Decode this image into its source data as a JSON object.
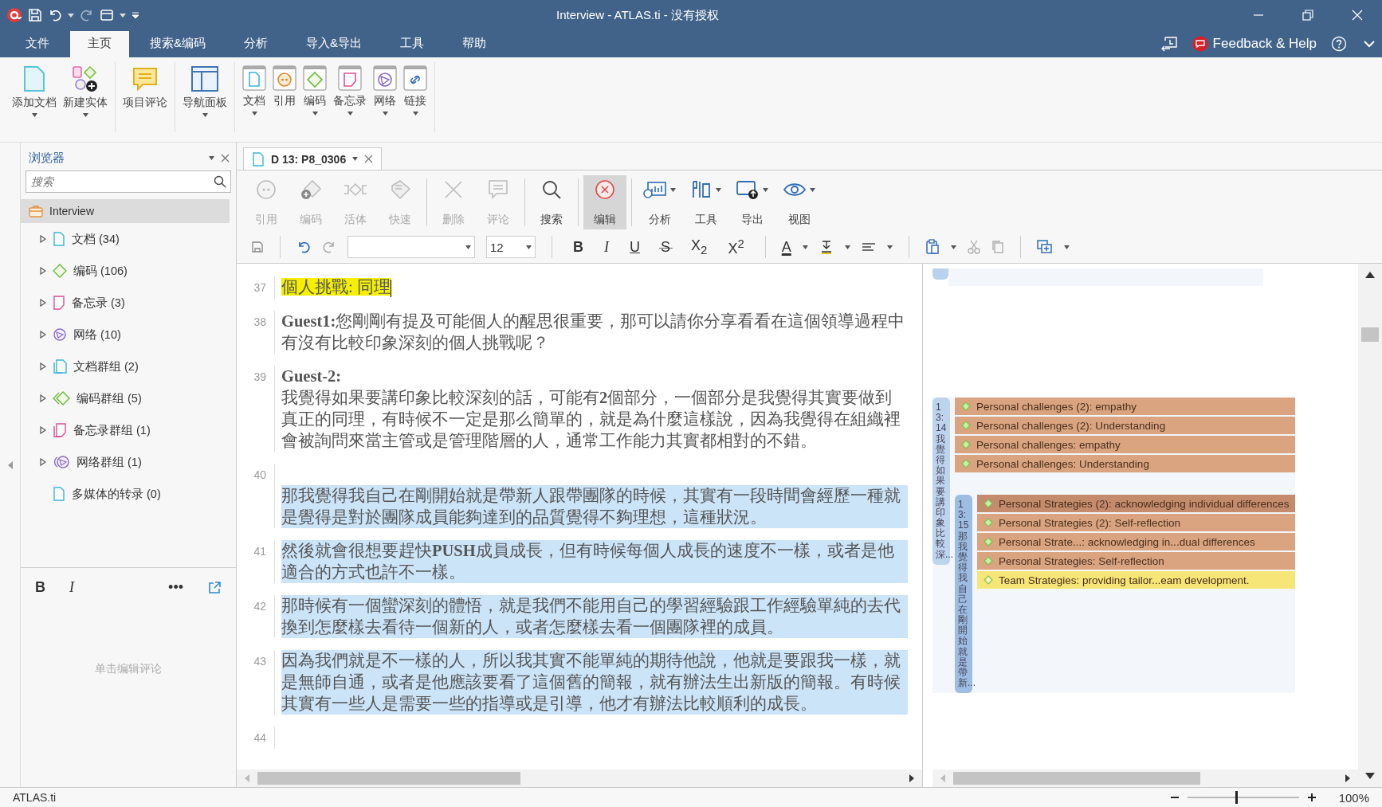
{
  "window": {
    "title": "Interview - ATLAS.ti - 没有授权"
  },
  "menu_tabs": [
    {
      "label": "文件",
      "selected": false
    },
    {
      "label": "主页",
      "selected": true
    },
    {
      "label": "搜索&编码",
      "selected": false
    },
    {
      "label": "分析",
      "selected": false
    },
    {
      "label": "导入&导出",
      "selected": false
    },
    {
      "label": "工具",
      "selected": false
    },
    {
      "label": "帮助",
      "selected": false
    }
  ],
  "feedback": "Feedback & Help",
  "ribbon": [
    [
      {
        "label": "添加文档",
        "kind": "add-doc",
        "dropdown": true
      },
      {
        "label": "新建实体",
        "kind": "new-entity",
        "dropdown": true
      }
    ],
    [
      {
        "label": "项目评论",
        "kind": "comment",
        "dropdown": false
      }
    ],
    [
      {
        "label": "导航面板",
        "kind": "nav",
        "dropdown": true
      }
    ],
    [
      {
        "label": "文档",
        "kind": "doc",
        "dropdown": true
      },
      {
        "label": "引用",
        "kind": "quote",
        "dropdown": false
      },
      {
        "label": "编码",
        "kind": "code",
        "dropdown": true
      },
      {
        "label": "备忘录",
        "kind": "memo",
        "dropdown": true
      },
      {
        "label": "网络",
        "kind": "network",
        "dropdown": true
      },
      {
        "label": "链接",
        "kind": "link",
        "dropdown": true
      }
    ]
  ],
  "browser": {
    "title": "浏览器",
    "search_placeholder": "搜索",
    "root": {
      "label": "Interview",
      "selected": true,
      "children": [
        {
          "label": "文档 (34)",
          "kind": "doc",
          "expandable": true,
          "selected": false
        },
        {
          "label": "编码 (106)",
          "kind": "code",
          "expandable": true,
          "selected": false
        },
        {
          "label": "备忘录 (3)",
          "kind": "memo",
          "expandable": true,
          "selected": false
        },
        {
          "label": "网络 (10)",
          "kind": "network",
          "expandable": true,
          "selected": false
        },
        {
          "label": "文档群组 (2)",
          "kind": "doc-group",
          "expandable": true,
          "selected": false
        },
        {
          "label": "编码群组 (5)",
          "kind": "code-group",
          "expandable": true,
          "selected": false
        },
        {
          "label": "备忘录群组 (1)",
          "kind": "memo-group",
          "expandable": true,
          "selected": false
        },
        {
          "label": "网络群组 (1)",
          "kind": "network-group",
          "expandable": true,
          "selected": false
        },
        {
          "label": "多媒体的转录 (0)",
          "kind": "media",
          "expandable": false,
          "selected": false
        }
      ]
    }
  },
  "comment": {
    "bold": "B",
    "italic": "I",
    "more": "•••",
    "placeholder": "单击编辑评论"
  },
  "editor_tab": {
    "label": "D 13: P8_0306"
  },
  "tools": [
    [
      {
        "label": "引用",
        "kind": "quote",
        "disabled": true,
        "pressed": false,
        "dropdown": false
      },
      {
        "label": "编码",
        "kind": "code",
        "disabled": true,
        "pressed": false,
        "dropdown": false
      },
      {
        "label": "活体",
        "kind": "live",
        "disabled": true,
        "pressed": false,
        "dropdown": false
      },
      {
        "label": "快速",
        "kind": "quick",
        "disabled": true,
        "pressed": false,
        "dropdown": false
      }
    ],
    [
      {
        "label": "删除",
        "kind": "delete",
        "disabled": true,
        "pressed": false,
        "dropdown": false
      },
      {
        "label": "评论",
        "kind": "comment",
        "disabled": true,
        "pressed": false,
        "dropdown": false
      }
    ],
    [
      {
        "label": "搜索",
        "kind": "search",
        "disabled": false,
        "pressed": false,
        "dropdown": false
      }
    ],
    [
      {
        "label": "编辑",
        "kind": "edit",
        "disabled": false,
        "pressed": true,
        "dropdown": false
      }
    ],
    [
      {
        "label": "分析",
        "kind": "analyze",
        "disabled": false,
        "pressed": false,
        "dropdown": true
      },
      {
        "label": "工具",
        "kind": "tools",
        "disabled": false,
        "pressed": false,
        "dropdown": true
      },
      {
        "label": "导出",
        "kind": "export",
        "disabled": false,
        "pressed": false,
        "dropdown": true
      },
      {
        "label": "视图",
        "kind": "view",
        "disabled": false,
        "pressed": false,
        "dropdown": true
      }
    ]
  ],
  "format": {
    "font_size": "12",
    "buttons": [
      {
        "label": "B",
        "kind": "bold"
      },
      {
        "label": "I",
        "kind": "italic"
      },
      {
        "label": "U",
        "kind": "underline"
      },
      {
        "label": "S",
        "kind": "strike"
      },
      {
        "label": "X$_{2}$",
        "kind": "sub"
      },
      {
        "label": "X$^{2}$",
        "kind": "sup"
      }
    ],
    "font_color": "A"
  },
  "paragraphs": [
    {
      "number": "37",
      "kind": "heading",
      "selected": false,
      "lines": [
        "個人挑戰: 同理"
      ]
    },
    {
      "number": "38",
      "kind": "text",
      "selected": false,
      "lines": [
        "**Guest1:**您剛剛有提及可能個人的醒思很重要，那可以請你分享看看在這個領導過程中有沒有比較印象深刻的個人挑戰呢？"
      ]
    },
    {
      "number": "39",
      "kind": "text",
      "selected": false,
      "lines": [
        "**Guest-2:**",
        "我覺得如果要講印象比較深刻的話，可能有**2**個部分，一個部分是我覺得其實要做到真正的同理，有時候不一定是那么簡單的，就是為什麼這樣說，因為我覺得在組織裡會被詢問來當主管或是管理階層的人，通常工作能力其實都相對的不錯。"
      ]
    },
    {
      "number": "40",
      "kind": "spaced-text",
      "selected": true,
      "lines": [
        "那我覺得我自己在剛開始就是帶新人跟帶團隊的時候，其實有一段時間會經歷一種就是覺得是對於團隊成員能夠達到的品質覺得不夠理想，這種狀況。"
      ]
    },
    {
      "number": "41",
      "kind": "text",
      "selected": true,
      "lines": [
        "然後就會很想要趕快**PUSH**成員成長，但有時候每個人成長的速度不一樣，或者是他適合的方式也許不一樣。"
      ]
    },
    {
      "number": "42",
      "kind": "text",
      "selected": true,
      "lines": [
        "那時候有一個蠻深刻的體悟，就是我們不能用自己的學習經驗跟工作經驗單純的去代換到怎麼樣去看待一個新的人，或者怎麼樣去看一個團隊裡的成員。"
      ]
    },
    {
      "number": "43",
      "kind": "text",
      "selected": true,
      "lines": [
        "因為我們就是不一樣的人，所以我其實不能單純的期待他說，他就是要跟我一樣，就是無師自通，或者是他應該要看了這個舊的簡報，就有辦法生出新版的簡報。有時候其實有一些人是需要一些的指導或是引導，他才有辦法比較順利的成長。"
      ]
    }
  ],
  "trailing_line_number": "44",
  "margin_quotes": [
    {
      "label": "13:14 我覺得如果要講印象比較深...",
      "codes": [
        {
          "label": "Personal challenges (2): empathy",
          "color": "#d9a47f"
        },
        {
          "label": "Personal challenges (2): Understanding",
          "color": "#d9a47f"
        },
        {
          "label": "Personal challenges: empathy",
          "color": "#d9a47f"
        },
        {
          "label": "Personal challenges: Understanding",
          "color": "#d9a47f"
        }
      ],
      "children": [
        {
          "label": "13:15 那我覺得我自己在剛開始就是帶新...",
          "codes": [
            {
              "label": "Personal Strategies (2): acknowledging individual differences",
              "color": "#c48b6c"
            },
            {
              "label": "Personal Strategies (2): Self-reflection",
              "color": "#d9a47f"
            },
            {
              "label": "Personal Strate...: acknowledging in...dual differences",
              "color": "#d9a47f"
            },
            {
              "label": "Personal Strategies: Self-reflection",
              "color": "#d9a47f"
            },
            {
              "label": "Team Strategies: providing tailor...eam development.",
              "color": "#f6e678"
            }
          ]
        }
      ]
    }
  ],
  "status_bar": {
    "app": "ATLAS.ti",
    "zoom": {
      "level": 0.43,
      "reading": "100%"
    }
  }
}
